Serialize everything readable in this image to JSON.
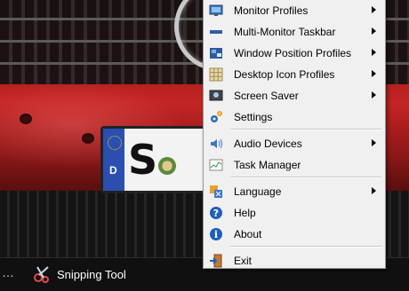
{
  "menu": {
    "items": [
      {
        "label": "Monitor Profiles",
        "icon": "monitor-icon",
        "submenu": true
      },
      {
        "label": "Multi-Monitor Taskbar",
        "icon": "taskbar-icon",
        "submenu": true
      },
      {
        "label": "Window Position Profiles",
        "icon": "window-position-icon",
        "submenu": true
      },
      {
        "label": "Desktop Icon Profiles",
        "icon": "desktop-icons-grid-icon",
        "submenu": true
      },
      {
        "label": "Screen Saver",
        "icon": "screen-saver-icon",
        "submenu": true
      },
      {
        "label": "Settings",
        "icon": "gears-icon",
        "submenu": false
      },
      {
        "label": "Audio Devices",
        "icon": "speaker-icon",
        "submenu": true
      },
      {
        "label": "Task Manager",
        "icon": "task-manager-icon",
        "submenu": false
      },
      {
        "label": "Language",
        "icon": "language-icon",
        "submenu": true
      },
      {
        "label": "Help",
        "icon": "help-icon",
        "submenu": false
      },
      {
        "label": "About",
        "icon": "info-icon",
        "submenu": false
      },
      {
        "label": "Exit",
        "icon": "exit-door-icon",
        "submenu": false
      }
    ]
  },
  "taskbar": {
    "overflow": "…",
    "snipping_tool_label": "Snipping Tool"
  },
  "wallpaper": {
    "plate_text": "S M",
    "plate_country": "D"
  },
  "colors": {
    "menu_bg": "#f0f0f0",
    "taskbar_bg": "#101010",
    "car_red": "#c42424"
  }
}
